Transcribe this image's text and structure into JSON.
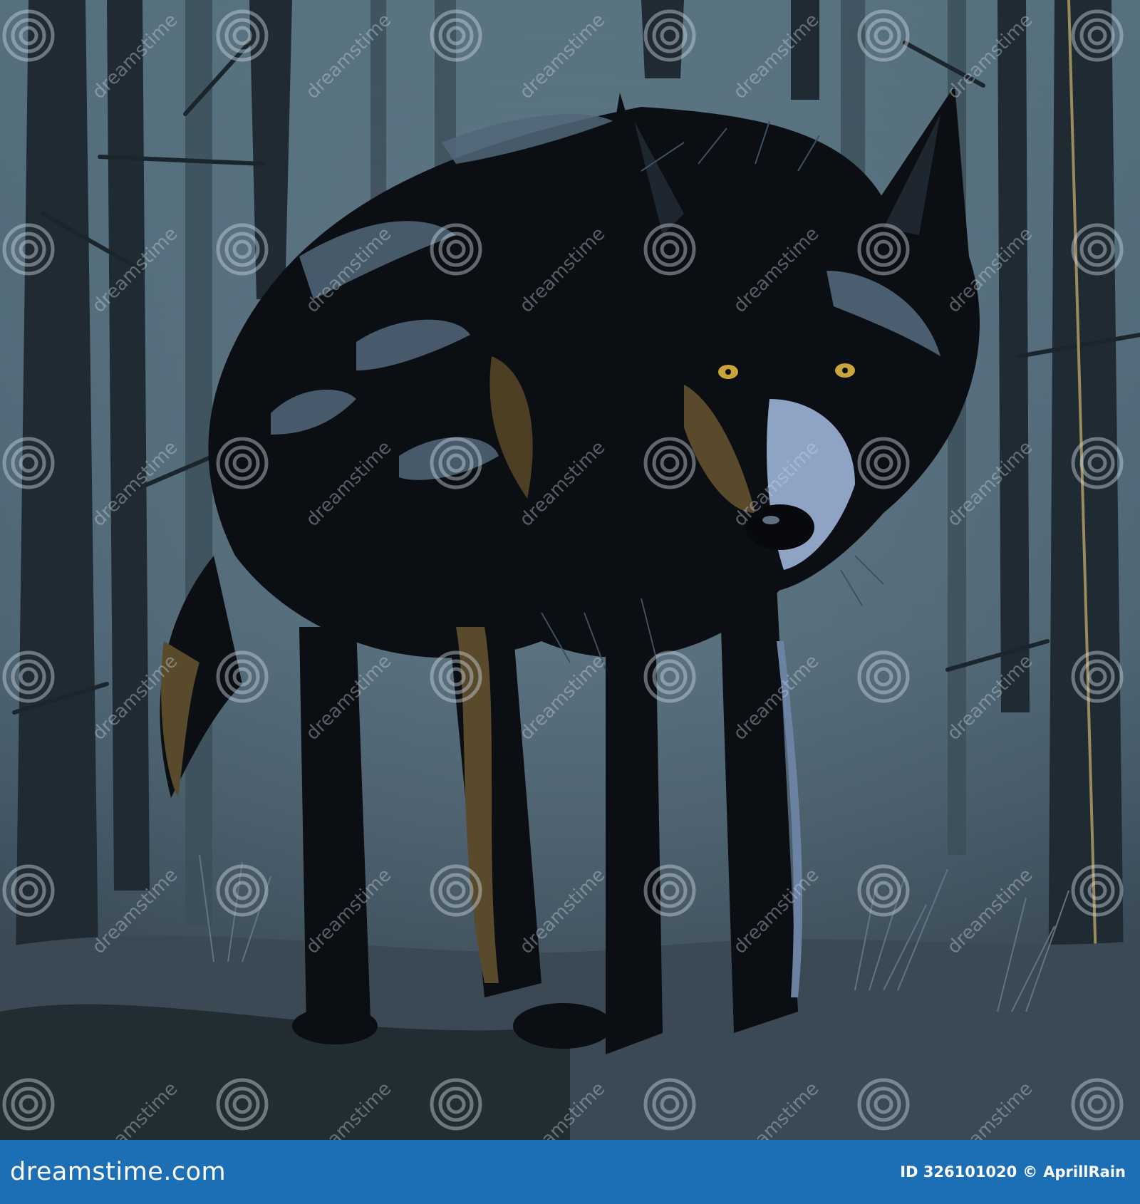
{
  "watermark": {
    "text": "dreamstime",
    "icon": "spiral-logo-icon"
  },
  "footer": {
    "logo_text": "dreamstime.com",
    "image_id": "ID 326101020",
    "copyright_symbol": "©",
    "author": "AprillRain",
    "background_color": "#1c6eb5"
  },
  "palette": {
    "sky": "#5c7482",
    "fur": "#0b0e12",
    "fur_highlight": "#52677a",
    "eye": "#c8a43a",
    "muzzle": "#8fa3c4",
    "ground": "#3e4e5b"
  }
}
